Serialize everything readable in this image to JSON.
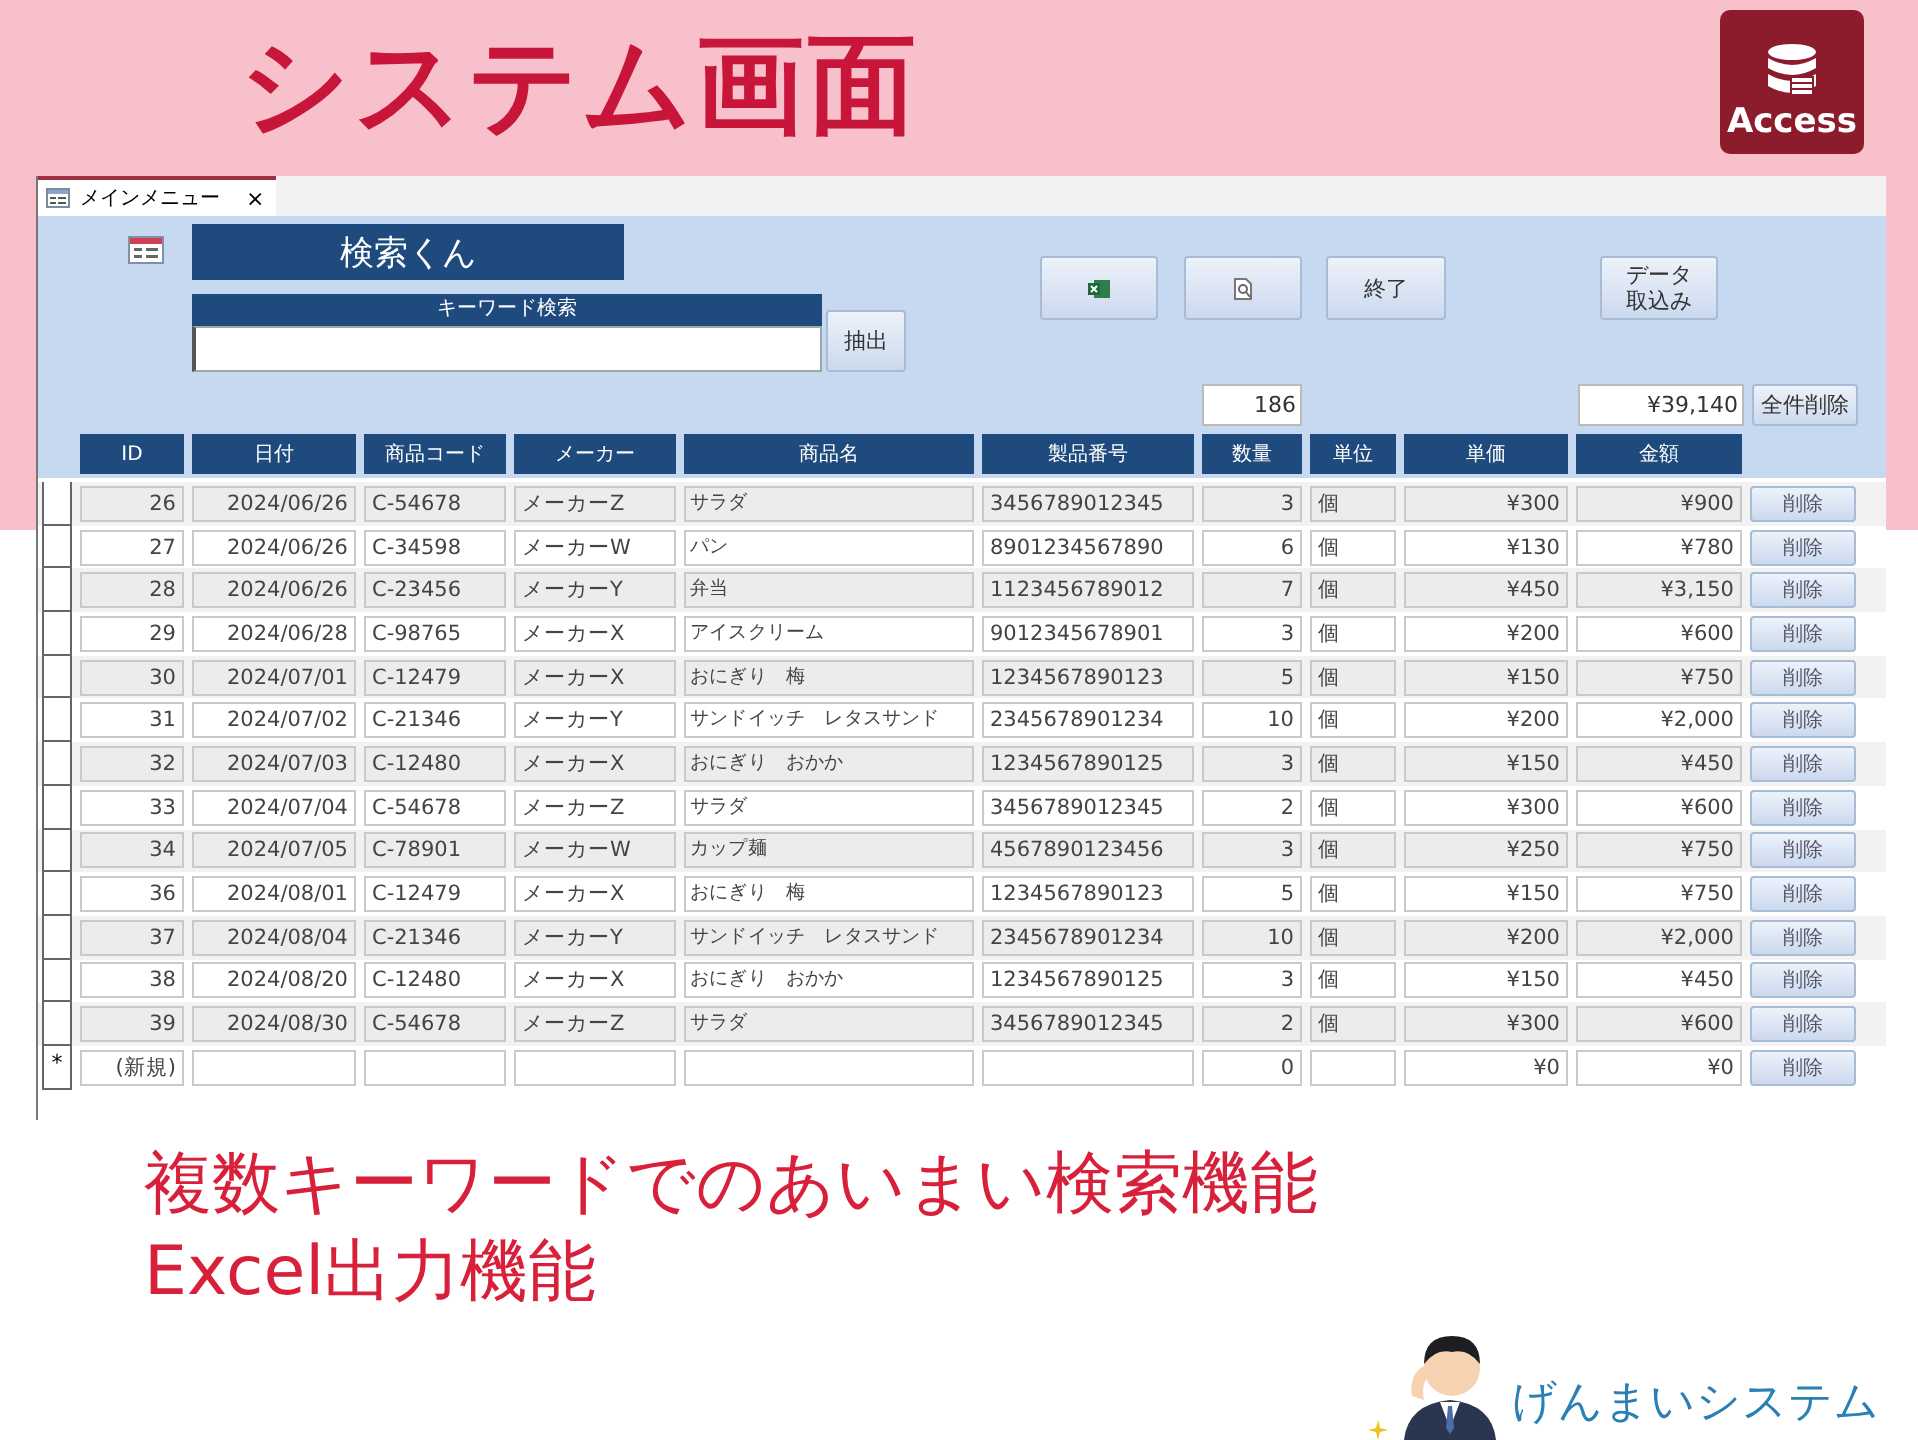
{
  "slide_title": "システム画面",
  "app_badge": {
    "label": "Access"
  },
  "window": {
    "tab": {
      "label": "メインメニュー",
      "close": "×",
      "selected": true
    }
  },
  "form": {
    "title": "検索くん",
    "keyword": {
      "label": "キーワード検索"
    },
    "extract_button": "抽出",
    "toolbar": [
      {
        "kind": "excel"
      },
      {
        "kind": "preview"
      },
      {
        "kind": "text",
        "label": "終了"
      }
    ],
    "import_button": [
      "データ",
      "取込み"
    ],
    "totals": {
      "quantity": "186",
      "amount": "¥39,140"
    },
    "delete_all_button": "全件削除"
  },
  "table": {
    "columns": [
      "ID",
      "日付",
      "商品コード",
      "メーカー",
      "商品名",
      "製品番号",
      "数量",
      "単位",
      "単価",
      "金額"
    ],
    "rows": [
      {
        "kind": "record",
        "id": "26",
        "date": "2024/06/26",
        "code": "C-54678",
        "maker": "メーカーZ",
        "name": "サラダ",
        "product_no": "3456789012345",
        "quantity": "3",
        "unit": "個",
        "price": "¥300",
        "amount": "¥900",
        "action": "削除"
      },
      {
        "kind": "record",
        "id": "27",
        "date": "2024/06/26",
        "code": "C-34598",
        "maker": "メーカーW",
        "name": "パン",
        "product_no": "8901234567890",
        "quantity": "6",
        "unit": "個",
        "price": "¥130",
        "amount": "¥780",
        "action": "削除"
      },
      {
        "kind": "record",
        "id": "28",
        "date": "2024/06/26",
        "code": "C-23456",
        "maker": "メーカーY",
        "name": "弁当",
        "product_no": "1123456789012",
        "quantity": "7",
        "unit": "個",
        "price": "¥450",
        "amount": "¥3,150",
        "action": "削除"
      },
      {
        "kind": "record",
        "id": "29",
        "date": "2024/06/28",
        "code": "C-98765",
        "maker": "メーカーX",
        "name": "アイスクリーム",
        "product_no": "9012345678901",
        "quantity": "3",
        "unit": "個",
        "price": "¥200",
        "amount": "¥600",
        "action": "削除"
      },
      {
        "kind": "record",
        "id": "30",
        "date": "2024/07/01",
        "code": "C-12479",
        "maker": "メーカーX",
        "name": "おにぎり　梅",
        "product_no": "1234567890123",
        "quantity": "5",
        "unit": "個",
        "price": "¥150",
        "amount": "¥750",
        "action": "削除"
      },
      {
        "kind": "record",
        "id": "31",
        "date": "2024/07/02",
        "code": "C-21346",
        "maker": "メーカーY",
        "name": "サンドイッチ　レタスサンド",
        "product_no": "2345678901234",
        "quantity": "10",
        "unit": "個",
        "price": "¥200",
        "amount": "¥2,000",
        "action": "削除"
      },
      {
        "kind": "record",
        "id": "32",
        "date": "2024/07/03",
        "code": "C-12480",
        "maker": "メーカーX",
        "name": "おにぎり　おかか",
        "product_no": "1234567890125",
        "quantity": "3",
        "unit": "個",
        "price": "¥150",
        "amount": "¥450",
        "action": "削除"
      },
      {
        "kind": "record",
        "id": "33",
        "date": "2024/07/04",
        "code": "C-54678",
        "maker": "メーカーZ",
        "name": "サラダ",
        "product_no": "3456789012345",
        "quantity": "2",
        "unit": "個",
        "price": "¥300",
        "amount": "¥600",
        "action": "削除"
      },
      {
        "kind": "record",
        "id": "34",
        "date": "2024/07/05",
        "code": "C-78901",
        "maker": "メーカーW",
        "name": "カップ麺",
        "product_no": "4567890123456",
        "quantity": "3",
        "unit": "個",
        "price": "¥250",
        "amount": "¥750",
        "action": "削除"
      },
      {
        "kind": "record",
        "id": "36",
        "date": "2024/08/01",
        "code": "C-12479",
        "maker": "メーカーX",
        "name": "おにぎり　梅",
        "product_no": "1234567890123",
        "quantity": "5",
        "unit": "個",
        "price": "¥150",
        "amount": "¥750",
        "action": "削除"
      },
      {
        "kind": "record",
        "id": "37",
        "date": "2024/08/04",
        "code": "C-21346",
        "maker": "メーカーY",
        "name": "サンドイッチ　レタスサンド",
        "product_no": "2345678901234",
        "quantity": "10",
        "unit": "個",
        "price": "¥200",
        "amount": "¥2,000",
        "action": "削除"
      },
      {
        "kind": "record",
        "id": "38",
        "date": "2024/08/20",
        "code": "C-12480",
        "maker": "メーカーX",
        "name": "おにぎり　おかか",
        "product_no": "1234567890125",
        "quantity": "3",
        "unit": "個",
        "price": "¥150",
        "amount": "¥450",
        "action": "削除"
      },
      {
        "kind": "record",
        "id": "39",
        "date": "2024/08/30",
        "code": "C-54678",
        "maker": "メーカーZ",
        "name": "サラダ",
        "product_no": "3456789012345",
        "quantity": "2",
        "unit": "個",
        "price": "¥300",
        "amount": "¥600",
        "action": "削除"
      },
      {
        "kind": "new",
        "marker": "*",
        "id": "(新規)",
        "quantity": "0",
        "price": "¥0",
        "amount": "¥0",
        "action": "削除"
      }
    ]
  },
  "features": [
    "複数キーワードでのあいまい検索機能",
    "Excel出力機能"
  ],
  "brand": "げんまいシステム"
}
